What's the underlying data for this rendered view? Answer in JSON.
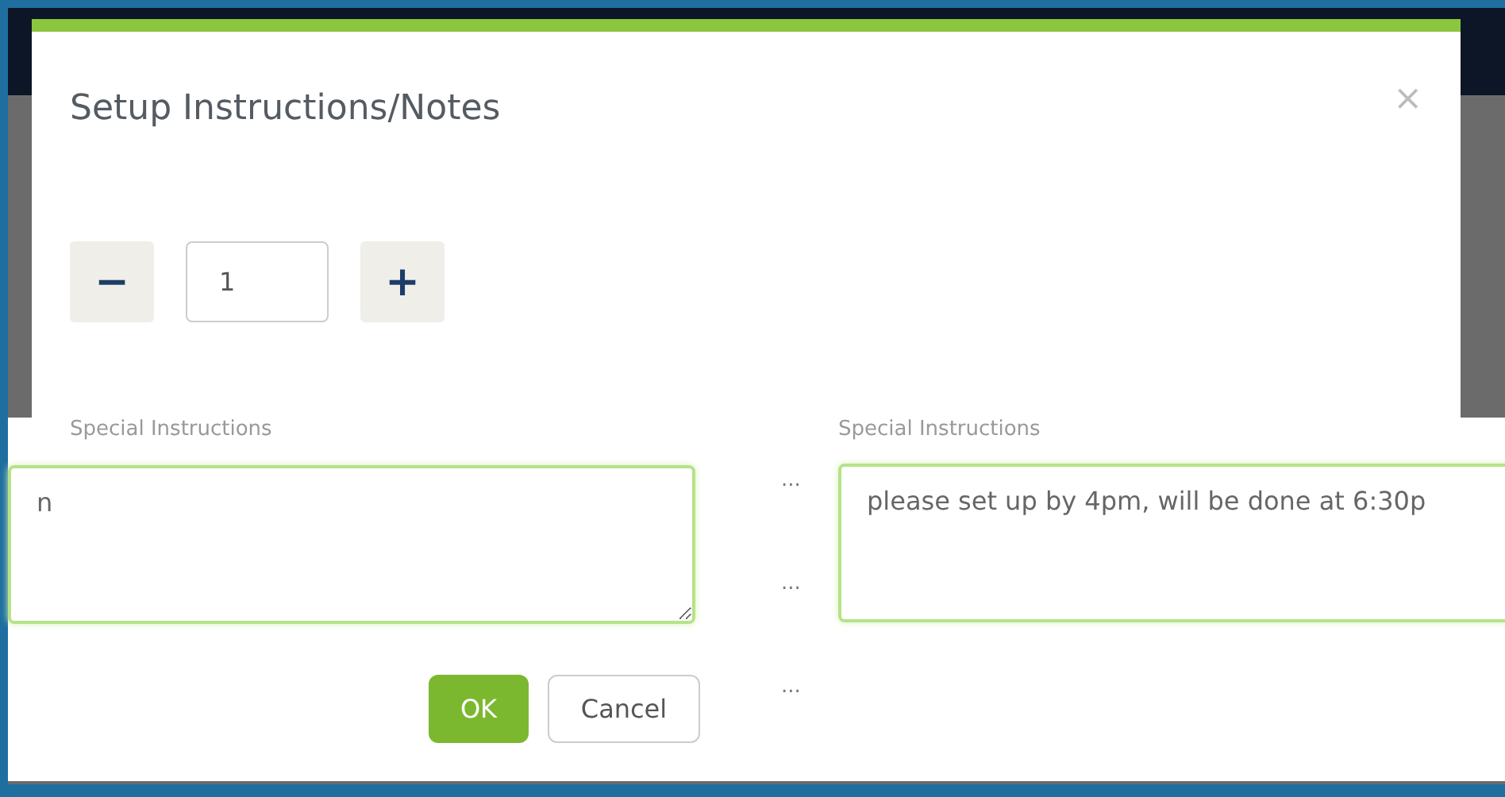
{
  "dialog": {
    "title": "Setup Instructions/Notes",
    "close": "×"
  },
  "stepper": {
    "minus": "−",
    "value": "1",
    "plus": "+"
  },
  "lower_panel": {
    "left_field": {
      "label": "Special Instructions",
      "value": "n"
    },
    "right_field": {
      "label": "Special Instructions",
      "value": "please set up by 4pm, will be done at 6:30p"
    },
    "dots": [
      "...",
      "...",
      "..."
    ],
    "buttons": [
      {
        "label": "OK",
        "kind": "primary"
      },
      {
        "label": "Cancel",
        "kind": "secondary"
      }
    ]
  }
}
